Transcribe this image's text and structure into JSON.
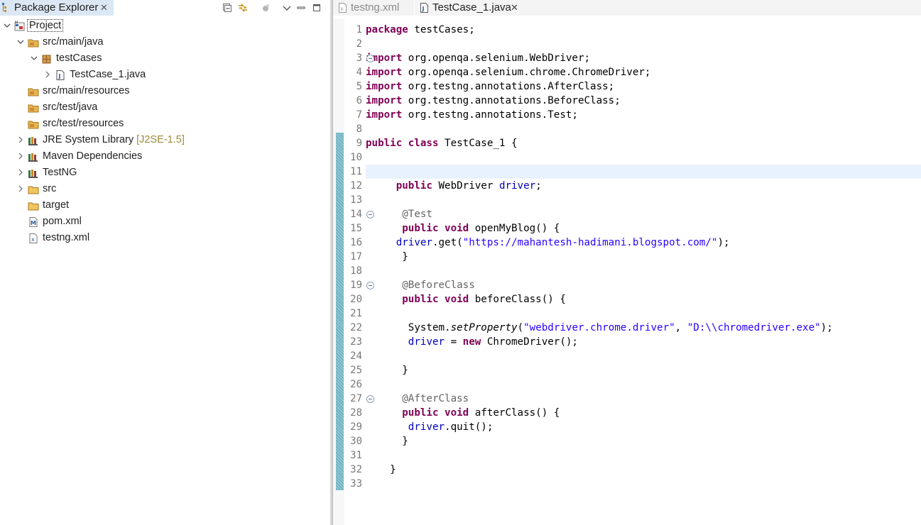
{
  "explorer": {
    "title": "Package Explorer",
    "close_glyph": "✕",
    "tree": [
      {
        "label": "Project",
        "depth": 0,
        "expanded": true,
        "icon": "project-icon"
      },
      {
        "label": "src/main/java",
        "depth": 1,
        "expanded": true,
        "icon": "source-folder-icon"
      },
      {
        "label": "testCases",
        "depth": 2,
        "expanded": true,
        "icon": "package-icon"
      },
      {
        "label": "TestCase_1.java",
        "depth": 3,
        "expanded": false,
        "icon": "java-file-icon"
      },
      {
        "label": "src/main/resources",
        "depth": 1,
        "icon": "source-folder-icon"
      },
      {
        "label": "src/test/java",
        "depth": 1,
        "icon": "source-folder-icon"
      },
      {
        "label": "src/test/resources",
        "depth": 1,
        "icon": "source-folder-icon"
      },
      {
        "label": "JRE System Library",
        "suffix": "[J2SE-1.5]",
        "depth": 1,
        "expanded": false,
        "icon": "library-icon"
      },
      {
        "label": "Maven Dependencies",
        "depth": 1,
        "expanded": false,
        "icon": "library-icon"
      },
      {
        "label": "TestNG",
        "depth": 1,
        "expanded": false,
        "icon": "library-icon"
      },
      {
        "label": "src",
        "depth": 1,
        "expanded": false,
        "icon": "folder-icon"
      },
      {
        "label": "target",
        "depth": 1,
        "icon": "folder-icon"
      },
      {
        "label": "pom.xml",
        "depth": 1,
        "icon": "maven-file-icon"
      },
      {
        "label": "testng.xml",
        "depth": 1,
        "icon": "xml-file-icon"
      }
    ]
  },
  "editor": {
    "tabs": [
      {
        "label": "testng.xml",
        "active": false,
        "icon": "xml-file-icon"
      },
      {
        "label": "TestCase_1.java",
        "active": true,
        "icon": "java-file-icon"
      }
    ],
    "close_glyph": "✕",
    "current_line": 11,
    "line_numbers": [
      "1",
      "2",
      "3",
      "4",
      "5",
      "6",
      "7",
      "8",
      "9",
      "10",
      "11",
      "12",
      "13",
      "14",
      "15",
      "16",
      "17",
      "18",
      "19",
      "20",
      "21",
      "22",
      "23",
      "24",
      "25",
      "26",
      "27",
      "28",
      "29",
      "30",
      "31",
      "32",
      "33"
    ],
    "fold_lines": [
      3,
      14,
      19,
      27
    ],
    "code": [
      {
        "t": [
          [
            "kw",
            "package"
          ],
          [
            "",
            " testCases;"
          ]
        ]
      },
      {
        "t": []
      },
      {
        "t": [
          [
            "kw",
            "import"
          ],
          [
            "",
            " org.openqa.selenium.WebDriver;"
          ]
        ]
      },
      {
        "t": [
          [
            "kw",
            "import"
          ],
          [
            "",
            " org.openqa.selenium.chrome.ChromeDriver;"
          ]
        ]
      },
      {
        "t": [
          [
            "kw",
            "import"
          ],
          [
            "",
            " org.testng.annotations.AfterClass;"
          ]
        ]
      },
      {
        "t": [
          [
            "kw",
            "import"
          ],
          [
            "",
            " org.testng.annotations.BeforeClass;"
          ]
        ]
      },
      {
        "t": [
          [
            "kw",
            "import"
          ],
          [
            "",
            " org.testng.annotations.Test;"
          ]
        ]
      },
      {
        "t": []
      },
      {
        "t": [
          [
            "kw",
            "public"
          ],
          [
            "",
            " "
          ],
          [
            "kw",
            "class"
          ],
          [
            "",
            " TestCase_1 {"
          ]
        ]
      },
      {
        "t": []
      },
      {
        "t": []
      },
      {
        "t": [
          [
            "",
            "     "
          ],
          [
            "kw",
            "public"
          ],
          [
            "",
            " WebDriver "
          ],
          [
            "fld",
            "driver"
          ],
          [
            "",
            ";"
          ]
        ]
      },
      {
        "t": []
      },
      {
        "t": [
          [
            "",
            "      "
          ],
          [
            "ann",
            "@Test"
          ]
        ]
      },
      {
        "t": [
          [
            "",
            "      "
          ],
          [
            "kw",
            "public"
          ],
          [
            "",
            " "
          ],
          [
            "kw",
            "void"
          ],
          [
            "",
            " openMyBlog() {"
          ]
        ]
      },
      {
        "t": [
          [
            "",
            "     "
          ],
          [
            "fld",
            "driver"
          ],
          [
            "",
            ".get("
          ],
          [
            "str",
            "\"https://mahantesh-hadimani.blogspot.com/\""
          ],
          [
            "",
            ");"
          ]
        ]
      },
      {
        "t": [
          [
            "",
            "      }"
          ]
        ]
      },
      {
        "t": []
      },
      {
        "t": [
          [
            "",
            "      "
          ],
          [
            "ann",
            "@BeforeClass"
          ]
        ]
      },
      {
        "t": [
          [
            "",
            "      "
          ],
          [
            "kw",
            "public"
          ],
          [
            "",
            " "
          ],
          [
            "kw",
            "void"
          ],
          [
            "",
            " beforeClass() {"
          ]
        ]
      },
      {
        "t": []
      },
      {
        "t": [
          [
            "",
            "       System."
          ],
          [
            "it",
            "setProperty"
          ],
          [
            "",
            "("
          ],
          [
            "str",
            "\"webdriver.chrome.driver\""
          ],
          [
            "",
            ", "
          ],
          [
            "str",
            "\"D:\\\\chromedriver.exe\""
          ],
          [
            "",
            ");"
          ]
        ]
      },
      {
        "t": [
          [
            "",
            "       "
          ],
          [
            "fld",
            "driver"
          ],
          [
            "",
            " = "
          ],
          [
            "kw",
            "new"
          ],
          [
            "",
            " ChromeDriver();"
          ]
        ]
      },
      {
        "t": []
      },
      {
        "t": [
          [
            "",
            "      }"
          ]
        ]
      },
      {
        "t": []
      },
      {
        "t": [
          [
            "",
            "      "
          ],
          [
            "ann",
            "@AfterClass"
          ]
        ]
      },
      {
        "t": [
          [
            "",
            "      "
          ],
          [
            "kw",
            "public"
          ],
          [
            "",
            " "
          ],
          [
            "kw",
            "void"
          ],
          [
            "",
            " afterClass() {"
          ]
        ]
      },
      {
        "t": [
          [
            "",
            "       "
          ],
          [
            "fld",
            "driver"
          ],
          [
            "",
            ".quit();"
          ]
        ]
      },
      {
        "t": [
          [
            "",
            "      }"
          ]
        ]
      },
      {
        "t": []
      },
      {
        "t": [
          [
            "",
            "    }"
          ]
        ]
      },
      {
        "t": []
      }
    ]
  },
  "colors": {
    "keyword": "#7f0055",
    "field": "#0000c0",
    "string": "#2a00ff",
    "annotation": "#646464",
    "change_bar": "#6fb4c4",
    "current_line": "#e8f2fe",
    "selected_tab": "#dbe8f4"
  }
}
